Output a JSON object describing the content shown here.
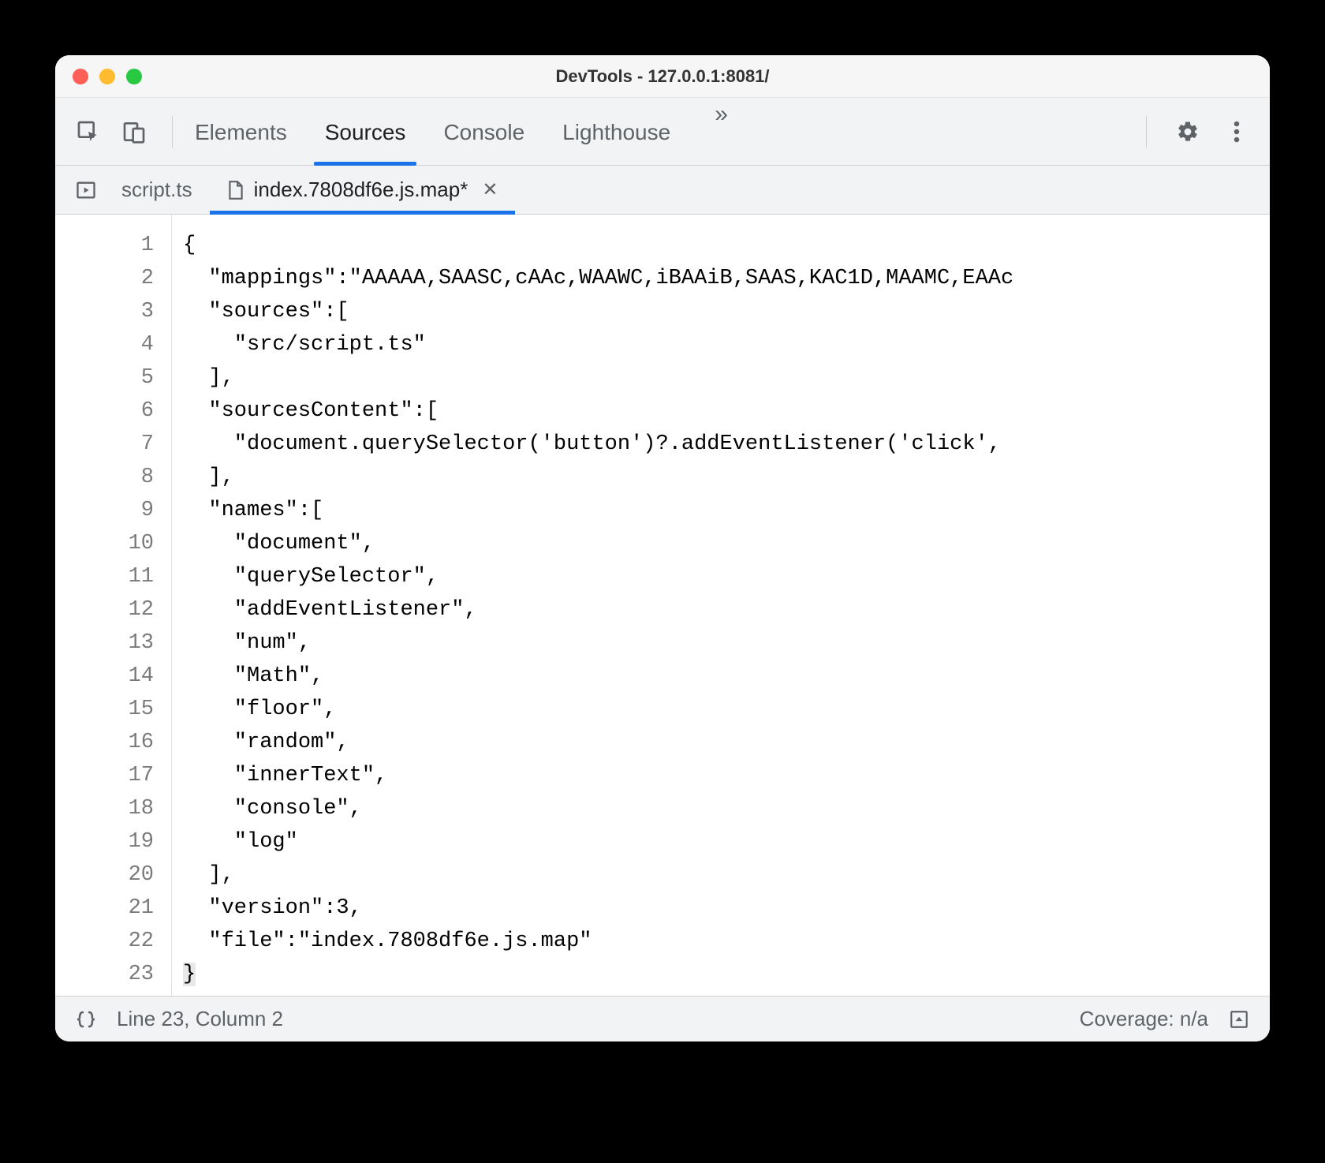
{
  "window": {
    "title": "DevTools - 127.0.0.1:8081/"
  },
  "toolbar": {
    "panels": [
      "Elements",
      "Sources",
      "Console",
      "Lighthouse"
    ],
    "active_panel": "Sources"
  },
  "file_tabs": [
    {
      "label": "script.ts",
      "active": false,
      "modified": false,
      "closeable": false
    },
    {
      "label": "index.7808df6e.js.map*",
      "active": true,
      "modified": true,
      "closeable": true
    }
  ],
  "code_lines": [
    "{",
    "  \"mappings\":\"AAAAA,SAASC,cAAc,WAAWC,iBAAiB,SAAS,KAC1D,MAAMC,EAAc",
    "  \"sources\":[",
    "    \"src/script.ts\"",
    "  ],",
    "  \"sourcesContent\":[",
    "    \"document.querySelector('button')?.addEventListener('click',",
    "  ],",
    "  \"names\":[",
    "    \"document\",",
    "    \"querySelector\",",
    "    \"addEventListener\",",
    "    \"num\",",
    "    \"Math\",",
    "    \"floor\",",
    "    \"random\",",
    "    \"innerText\",",
    "    \"console\",",
    "    \"log\"",
    "  ],",
    "  \"version\":3,",
    "  \"file\":\"index.7808df6e.js.map\"",
    "}"
  ],
  "statusbar": {
    "position": "Line 23, Column 2",
    "coverage": "Coverage: n/a"
  }
}
